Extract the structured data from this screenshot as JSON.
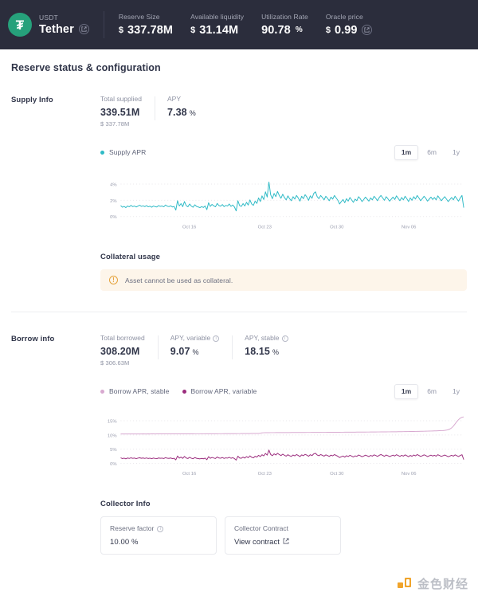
{
  "header": {
    "token_symbol": "USDT",
    "token_name": "Tether",
    "token_glyph": "₮",
    "external_link_icon": "external-link-icon",
    "stats": [
      {
        "label": "Reserve Size",
        "currency": "$",
        "value": "337.78M",
        "unit": "",
        "has_link": false
      },
      {
        "label": "Available liquidity",
        "currency": "$",
        "value": "31.14M",
        "unit": "",
        "has_link": false
      },
      {
        "label": "Utilization Rate",
        "currency": "",
        "value": "90.78",
        "unit": "%",
        "has_link": false
      },
      {
        "label": "Oracle price",
        "currency": "$",
        "value": "0.99",
        "unit": "",
        "has_link": true
      }
    ]
  },
  "card": {
    "title": "Reserve status & configuration"
  },
  "supply": {
    "section_label": "Supply Info",
    "metrics": [
      {
        "label": "Total supplied",
        "value": "339.51M",
        "unit": "",
        "sub": "$ 337.78M",
        "info": false
      },
      {
        "label": "APY",
        "value": "7.38",
        "unit": "%",
        "sub": "",
        "info": false
      }
    ],
    "legend": [
      {
        "label": "Supply APR",
        "color": "#2ebac6"
      }
    ],
    "range": {
      "options": [
        "1m",
        "6m",
        "1y"
      ],
      "selected": "1m"
    },
    "collateral_title": "Collateral usage",
    "collateral_alert": "Asset cannot be used as collateral."
  },
  "borrow": {
    "section_label": "Borrow info",
    "metrics": [
      {
        "label": "Total borrowed",
        "value": "308.20M",
        "unit": "",
        "sub": "$ 306.63M",
        "info": false
      },
      {
        "label": "APY, variable",
        "value": "9.07",
        "unit": "%",
        "sub": "",
        "info": true
      },
      {
        "label": "APY, stable",
        "value": "18.15",
        "unit": "%",
        "sub": "",
        "info": true
      }
    ],
    "legend": [
      {
        "label": "Borrow APR, stable",
        "color": "#d8a9d0"
      },
      {
        "label": "Borrow APR, variable",
        "color": "#9b2c7d"
      }
    ],
    "range": {
      "options": [
        "1m",
        "6m",
        "1y"
      ],
      "selected": "1m"
    },
    "collector_title": "Collector Info",
    "collector_cards": [
      {
        "label": "Reserve factor",
        "value": "10.00 %",
        "info": true,
        "link": false
      },
      {
        "label": "Collector Contract",
        "value": "View contract",
        "info": false,
        "link": true
      }
    ]
  },
  "watermark": {
    "text": "金色财经",
    "accent": "#f0a020"
  },
  "chart_data": [
    {
      "id": "supply-apr-chart",
      "type": "line",
      "title": "Supply APR",
      "xlabel": "",
      "ylabel": "",
      "ylim": [
        0,
        5
      ],
      "yticks": [
        0,
        2,
        4
      ],
      "ytick_labels": [
        "0%",
        "2%",
        "4%"
      ],
      "xticks": [
        "Oct 16",
        "Oct 23",
        "Oct 30",
        "Nov 06"
      ],
      "xtick_positions": [
        0.2,
        0.42,
        0.63,
        0.84
      ],
      "grid": true,
      "legend_position": "top-left",
      "series": [
        {
          "name": "Supply APR",
          "color": "#2ebac6",
          "values": [
            1.35,
            1.15,
            1.25,
            1.1,
            1.3,
            1.2,
            1.38,
            1.22,
            1.3,
            1.18,
            1.28,
            1.4,
            1.25,
            1.32,
            1.22,
            1.35,
            1.2,
            1.28,
            1.15,
            1.3,
            1.22,
            1.18,
            1.35,
            1.25,
            1.3,
            1.2,
            1.42,
            1.28,
            1.22,
            1.32,
            1.18,
            1.25,
            0.8,
            1.95,
            1.3,
            1.6,
            1.22,
            1.85,
            1.35,
            1.2,
            1.55,
            1.28,
            1.15,
            1.45,
            1.25,
            1.18,
            1.1,
            1.22,
            1.12,
            1.3,
            0.85,
            1.7,
            1.25,
            1.5,
            1.32,
            1.2,
            1.62,
            1.35,
            1.28,
            1.48,
            1.22,
            1.38,
            1.3,
            1.55,
            1.25,
            1.42,
            1.18,
            0.7,
            1.95,
            1.35,
            1.25,
            1.6,
            1.3,
            1.75,
            1.42,
            2.05,
            1.55,
            1.38,
            1.9,
            1.62,
            2.3,
            1.85,
            2.55,
            2.1,
            3.05,
            2.4,
            4.25,
            2.7,
            2.2,
            2.85,
            2.45,
            3.1,
            2.6,
            2.25,
            2.75,
            2.35,
            2.05,
            2.55,
            2.2,
            1.95,
            2.45,
            2.15,
            2.6,
            2.3,
            1.9,
            2.5,
            2.2,
            2.7,
            2.4,
            2.0,
            2.55,
            2.25,
            2.85,
            3.05,
            2.45,
            2.2,
            2.6,
            2.35,
            2.05,
            2.5,
            2.25,
            1.95,
            2.4,
            2.15,
            2.6,
            2.3,
            2.0,
            1.55,
            1.85,
            2.1,
            1.7,
            2.2,
            1.9,
            2.35,
            2.05,
            1.75,
            2.15,
            1.95,
            2.45,
            2.2,
            1.85,
            2.1,
            2.4,
            2.15,
            1.9,
            2.3,
            2.05,
            2.5,
            2.25,
            1.95,
            2.35,
            2.6,
            2.3,
            2.0,
            2.45,
            2.2,
            1.9,
            2.15,
            2.4,
            2.1,
            2.55,
            2.25,
            1.95,
            2.35,
            2.05,
            2.5,
            2.2,
            1.85,
            2.3,
            2.0,
            2.45,
            2.15,
            2.6,
            2.3,
            1.95,
            2.2,
            2.5,
            2.25,
            1.9,
            2.15,
            2.4,
            2.1,
            2.35,
            2.05,
            2.55,
            2.25,
            1.95,
            2.2,
            2.45,
            2.15,
            1.85,
            2.1,
            2.35,
            2.05,
            2.5,
            2.2,
            1.9,
            2.3,
            2.6,
            1.1
          ]
        }
      ]
    },
    {
      "id": "borrow-apr-chart",
      "type": "line",
      "title": "Borrow APR",
      "xlabel": "",
      "ylabel": "",
      "ylim": [
        0,
        17
      ],
      "yticks": [
        0,
        5,
        10,
        15
      ],
      "ytick_labels": [
        "0%",
        "5%",
        "10%",
        "15%"
      ],
      "xticks": [
        "Oct 16",
        "Oct 23",
        "Oct 30",
        "Nov 06"
      ],
      "xtick_positions": [
        0.2,
        0.42,
        0.63,
        0.84
      ],
      "grid": true,
      "legend_position": "top-left",
      "series": [
        {
          "name": "Borrow APR, stable",
          "color": "#d8a9d0",
          "values": [
            10.35,
            10.35,
            10.36,
            10.35,
            10.36,
            10.35,
            10.36,
            10.36,
            10.35,
            10.36,
            10.36,
            10.36,
            10.36,
            10.37,
            10.36,
            10.36,
            10.37,
            10.36,
            10.37,
            10.37,
            10.36,
            10.37,
            10.37,
            10.37,
            10.37,
            10.38,
            10.37,
            10.38,
            10.37,
            10.38,
            10.38,
            10.38,
            10.38,
            10.38,
            10.39,
            10.38,
            10.39,
            10.39,
            10.39,
            10.39,
            10.39,
            10.4,
            10.39,
            10.4,
            10.4,
            10.4,
            10.4,
            10.41,
            10.4,
            10.41,
            10.41,
            10.41,
            10.41,
            10.42,
            10.42,
            10.42,
            10.42,
            10.43,
            10.43,
            10.43,
            10.44,
            10.44,
            10.44,
            10.45,
            10.45,
            10.45,
            10.46,
            10.46,
            10.47,
            10.47,
            10.48,
            10.48,
            10.49,
            10.49,
            10.5,
            10.5,
            10.51,
            10.51,
            10.52,
            10.52,
            10.53,
            10.6,
            10.72,
            10.78,
            10.8,
            10.81,
            10.81,
            10.82,
            10.82,
            10.82,
            10.83,
            10.83,
            10.83,
            10.84,
            10.84,
            10.84,
            10.85,
            10.85,
            10.85,
            10.86,
            10.86,
            10.86,
            10.87,
            10.87,
            10.87,
            10.88,
            10.88,
            10.88,
            10.89,
            10.89,
            10.89,
            10.9,
            10.9,
            10.9,
            10.91,
            10.91,
            10.91,
            10.92,
            10.92,
            10.92,
            10.93,
            10.93,
            10.94,
            10.94,
            10.94,
            10.95,
            10.95,
            10.95,
            10.96,
            10.96,
            10.97,
            10.97,
            10.97,
            10.98,
            10.98,
            10.99,
            10.99,
            11.0,
            11.0,
            11.01,
            11.01,
            11.02,
            11.02,
            11.03,
            11.03,
            11.04,
            11.04,
            11.05,
            11.05,
            11.06,
            11.06,
            11.07,
            11.08,
            11.08,
            11.09,
            11.1,
            11.1,
            11.11,
            11.12,
            11.13,
            11.13,
            11.14,
            11.15,
            11.16,
            11.17,
            11.18,
            11.19,
            11.2,
            11.21,
            11.22,
            11.23,
            11.24,
            11.26,
            11.27,
            11.28,
            11.3,
            11.31,
            11.33,
            11.34,
            11.36,
            11.38,
            11.4,
            11.42,
            11.44,
            11.46,
            11.49,
            11.52,
            11.55,
            11.6,
            11.7,
            11.85,
            12.1,
            12.5,
            13.1,
            13.9,
            14.7,
            15.4,
            15.9,
            16.2,
            16.35
          ]
        },
        {
          "name": "Borrow APR, variable",
          "color": "#9b2c7d",
          "values": [
            1.95,
            1.7,
            1.85,
            1.6,
            1.9,
            1.75,
            1.95,
            1.78,
            1.88,
            1.68,
            1.85,
            1.98,
            1.8,
            1.9,
            1.75,
            1.92,
            1.72,
            1.85,
            1.65,
            1.88,
            1.75,
            1.68,
            1.9,
            1.8,
            1.85,
            1.72,
            2.0,
            1.84,
            1.76,
            1.9,
            1.68,
            1.8,
            1.25,
            2.6,
            1.85,
            2.2,
            1.76,
            2.45,
            1.9,
            1.72,
            2.15,
            1.82,
            1.65,
            2.05,
            1.8,
            1.7,
            1.6,
            1.76,
            1.62,
            1.85,
            1.3,
            2.35,
            1.8,
            2.1,
            1.88,
            1.72,
            2.25,
            1.9,
            1.82,
            2.08,
            1.75,
            1.95,
            1.85,
            2.15,
            1.8,
            2.0,
            1.7,
            1.15,
            2.55,
            1.9,
            1.8,
            2.2,
            1.85,
            2.4,
            2.0,
            2.65,
            2.15,
            1.95,
            2.5,
            2.2,
            2.85,
            2.4,
            3.05,
            2.65,
            3.5,
            2.9,
            4.7,
            3.15,
            2.7,
            3.35,
            2.95,
            3.55,
            3.1,
            2.75,
            3.25,
            2.85,
            2.55,
            3.05,
            2.7,
            2.45,
            2.95,
            2.65,
            3.1,
            2.8,
            2.4,
            3.0,
            2.7,
            3.2,
            2.9,
            2.5,
            3.05,
            2.75,
            3.35,
            3.55,
            2.95,
            2.7,
            3.1,
            2.85,
            2.55,
            3.0,
            2.75,
            2.45,
            2.9,
            2.65,
            3.1,
            2.8,
            2.5,
            2.05,
            2.35,
            2.6,
            2.2,
            2.7,
            2.4,
            2.85,
            2.55,
            2.25,
            2.65,
            2.45,
            2.95,
            2.7,
            2.35,
            2.6,
            2.9,
            2.65,
            2.4,
            2.8,
            2.55,
            3.0,
            2.75,
            2.45,
            2.85,
            3.1,
            2.8,
            2.5,
            2.95,
            2.7,
            2.4,
            2.65,
            2.9,
            2.6,
            3.05,
            2.75,
            2.45,
            2.85,
            2.55,
            3.0,
            2.7,
            2.35,
            2.8,
            2.5,
            2.95,
            2.65,
            3.1,
            2.8,
            2.45,
            2.7,
            3.0,
            2.75,
            2.4,
            2.65,
            2.9,
            2.6,
            2.85,
            2.55,
            3.05,
            2.75,
            2.45,
            2.7,
            2.95,
            2.65,
            2.35,
            2.6,
            2.85,
            2.55,
            3.0,
            2.7,
            2.4,
            2.8,
            3.05,
            1.35
          ]
        }
      ]
    }
  ]
}
